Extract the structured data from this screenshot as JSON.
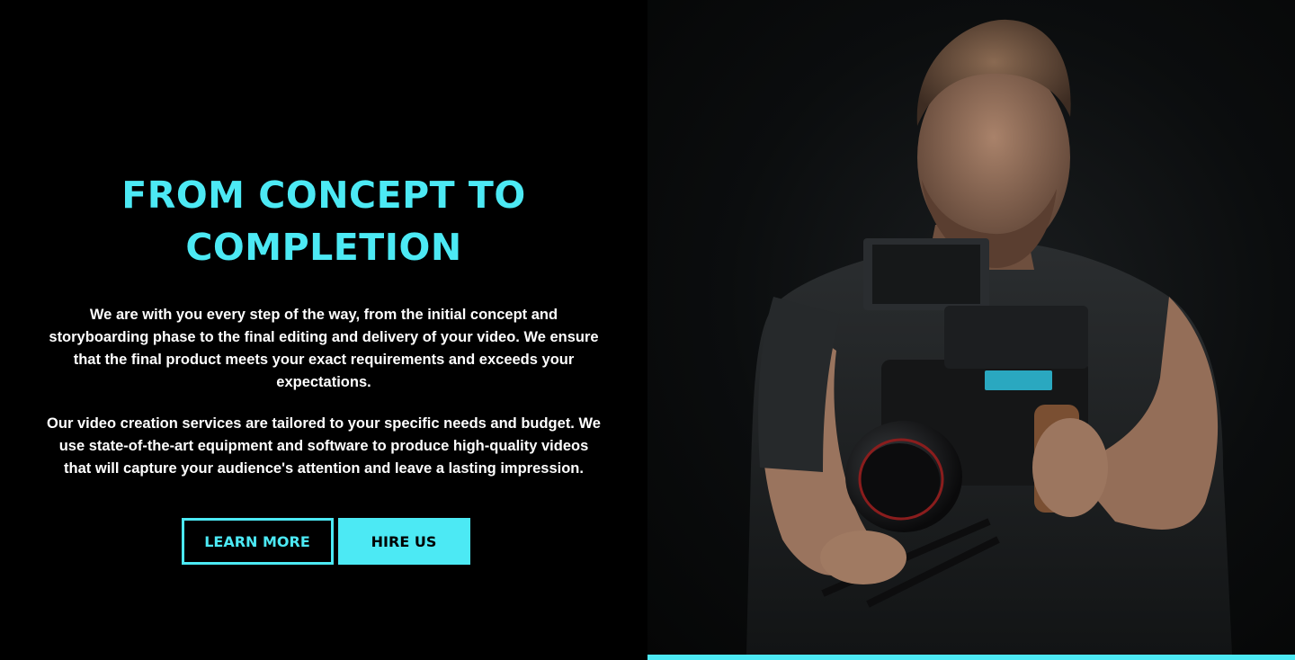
{
  "hero": {
    "title_line1": "FROM CONCEPT TO",
    "title_line2": "COMPLETION",
    "paragraph1": "We are with you every step of the way, from the initial concept and storyboarding phase to the final editing and delivery of your video. We ensure that the final product meets your exact requirements and exceeds your expectations.",
    "paragraph2": "Our video creation services are tailored to your specific needs and budget. We use state-of-the-art equipment and software to produce high-quality videos that will capture your audience's attention and leave a lasting impression."
  },
  "buttons": {
    "learn_more": "LEARN MORE",
    "hire_us": "HIRE US"
  },
  "colors": {
    "accent": "#4ce9f4",
    "background": "#000000",
    "text": "#ffffff"
  },
  "image": {
    "subject": "videographer-with-camera-rig"
  }
}
